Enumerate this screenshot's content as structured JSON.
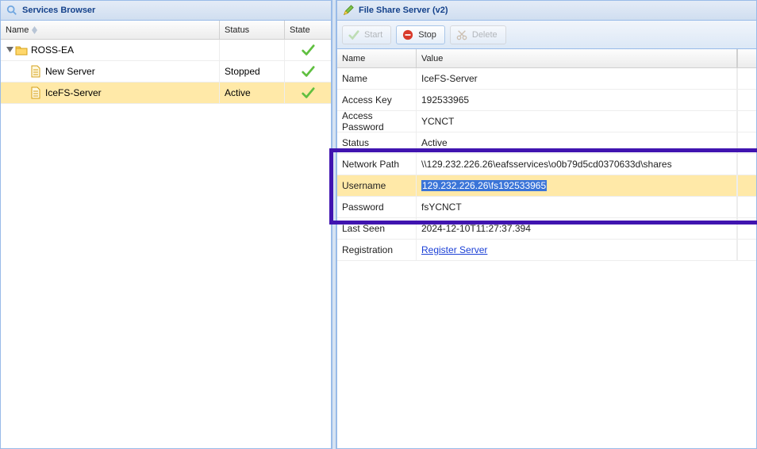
{
  "leftPanel": {
    "title": "Services Browser",
    "columns": {
      "name": "Name",
      "status": "Status",
      "state": "State"
    },
    "tree": {
      "root": {
        "label": "ROSS-EA"
      },
      "children": [
        {
          "label": "New Server",
          "status": "Stopped",
          "selected": false
        },
        {
          "label": "IceFS-Server",
          "status": "Active",
          "selected": true
        }
      ]
    }
  },
  "rightPanel": {
    "title": "File Share Server (v2)",
    "toolbar": {
      "start": "Start",
      "stop": "Stop",
      "delete": "Delete"
    },
    "columns": {
      "name": "Name",
      "value": "Value"
    },
    "rows": [
      {
        "k": "Name",
        "v": "IceFS-Server"
      },
      {
        "k": "Access Key",
        "v": "192533965"
      },
      {
        "k": "Access Password",
        "v": "YCNCT"
      },
      {
        "k": "Status",
        "v": "Active"
      },
      {
        "k": "Network Path",
        "v": "\\\\129.232.226.26\\eafsservices\\o0b79d5cd0370633d\\shares"
      },
      {
        "k": "Username",
        "v": "129.232.226.26\\fs192533965"
      },
      {
        "k": "Password",
        "v": "fsYCNCT"
      },
      {
        "k": "Last Seen",
        "v": "2024-12-10T11:27:37.394"
      },
      {
        "k": "Registration",
        "v": "Register Server"
      }
    ]
  }
}
